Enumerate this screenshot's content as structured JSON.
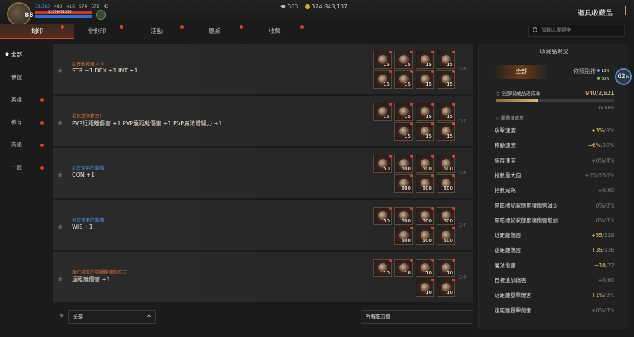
{
  "player": {
    "level": "88",
    "stat1": "33,763",
    "stat2": "483",
    "stat3": "416",
    "stat4": "574",
    "stat5": "572",
    "stat6": "43",
    "hp": "31590/31590"
  },
  "currency": {
    "gems": "363",
    "gold": "374,848,137"
  },
  "header": {
    "title": "道具收藏品"
  },
  "tabs": [
    {
      "label": "刻印"
    },
    {
      "label": "非刻印"
    },
    {
      "label": "活動"
    },
    {
      "label": "殿編"
    },
    {
      "label": "收集"
    }
  ],
  "search": {
    "placeholder": "請輸入關鍵字"
  },
  "sidebar": {
    "items": [
      {
        "label": "全部"
      },
      {
        "label": "傳說"
      },
      {
        "label": "英雄"
      },
      {
        "label": "稀有"
      },
      {
        "label": "高級"
      },
      {
        "label": "一般"
      }
    ]
  },
  "collections": [
    {
      "category": "武器收藏達人 II",
      "category_color": "#d9703a",
      "bonus": "STR +1 DEX +1 INT +1",
      "count": "0/8",
      "items_row1": [
        "15",
        "15",
        "15",
        "15"
      ],
      "items_row2": [
        "15",
        "15",
        "15",
        "15"
      ]
    },
    {
      "category": "我就是弱霸王！",
      "category_color": "#d9703a",
      "bonus": "PVP近距離傷害 +1 PVP遠距離傷害 +1 PVP魔法增幅力 +1",
      "count": "0/7",
      "items_row1": [
        "15",
        "15",
        "15",
        "15"
      ],
      "items_row2": [
        "15",
        "15",
        "15"
      ]
    },
    {
      "category": "武官使用的裝備",
      "category_color": "#4a8ad8",
      "bonus": "CON +1",
      "count": "0/7",
      "items_row1": [
        "50",
        "500",
        "500",
        "500"
      ],
      "items_row2": [
        "500",
        "500",
        "500"
      ]
    },
    {
      "category": "神官使用的裝備",
      "category_color": "#4a8ad8",
      "bonus": "WIS +1",
      "count": "0/7",
      "items_row1": [
        "50",
        "500",
        "500",
        "500"
      ],
      "items_row2": [
        "500",
        "500",
        "500"
      ]
    },
    {
      "category": "精打細算的狩獵稱號的方法",
      "category_color": "#d9703a",
      "bonus": "遠距離傷害 +1",
      "count": "0/6",
      "items_row1": [
        "10",
        "10",
        "10",
        "10"
      ],
      "items_row2": [
        "10",
        "10"
      ]
    }
  ],
  "filters": {
    "rarity": "全部",
    "ability": "所有能力值"
  },
  "panel": {
    "title": "收藏品現況",
    "tab_all": "全部",
    "tab_other": "依照別排",
    "percent": "62",
    "percent_unit": "%",
    "mini1": "13%",
    "mini2": "30%",
    "rate_label": "◇ 全部收藏品達成率",
    "rate_value": "940/2,621",
    "rate_fraction": 0.3586,
    "rate_pct": "35.86%",
    "effect_label": "◇ 圖鑑達成度",
    "stats": [
      {
        "name": "攻擊速度",
        "cur": "+3%",
        "max": "/9%",
        "gold": true
      },
      {
        "name": "移動速度",
        "cur": "+6%",
        "max": "/30%",
        "gold": true
      },
      {
        "name": "施展速度",
        "cur": "+0%",
        "max": "/4%",
        "gold": false
      },
      {
        "name": "指數最大值",
        "cur": "+0%",
        "max": "/150%",
        "gold": false
      },
      {
        "name": "指數減免",
        "cur": "+0",
        "max": "/60",
        "gold": false
      },
      {
        "name": "黑暗標記狀態累積傷害減少",
        "cur": "0%",
        "max": "/8%",
        "gold": false
      },
      {
        "name": "黑暗標記狀態累積傷害增加",
        "cur": "0%",
        "max": "/3%",
        "gold": false
      },
      {
        "name": "近距離傷害",
        "cur": "+55",
        "max": "/129",
        "gold": true
      },
      {
        "name": "遠距離傷害",
        "cur": "+35",
        "max": "/136",
        "gold": true
      },
      {
        "name": "魔法傷害",
        "cur": "+10",
        "max": "/77",
        "gold": true
      },
      {
        "name": "目標追加傷害",
        "cur": "+0",
        "max": "/60",
        "gold": false
      },
      {
        "name": "近距離暴擊傷害",
        "cur": "+1%",
        "max": "/3%",
        "gold": true
      },
      {
        "name": "遠距離暴擊傷害",
        "cur": "+0%",
        "max": "/3%",
        "gold": false
      }
    ]
  }
}
